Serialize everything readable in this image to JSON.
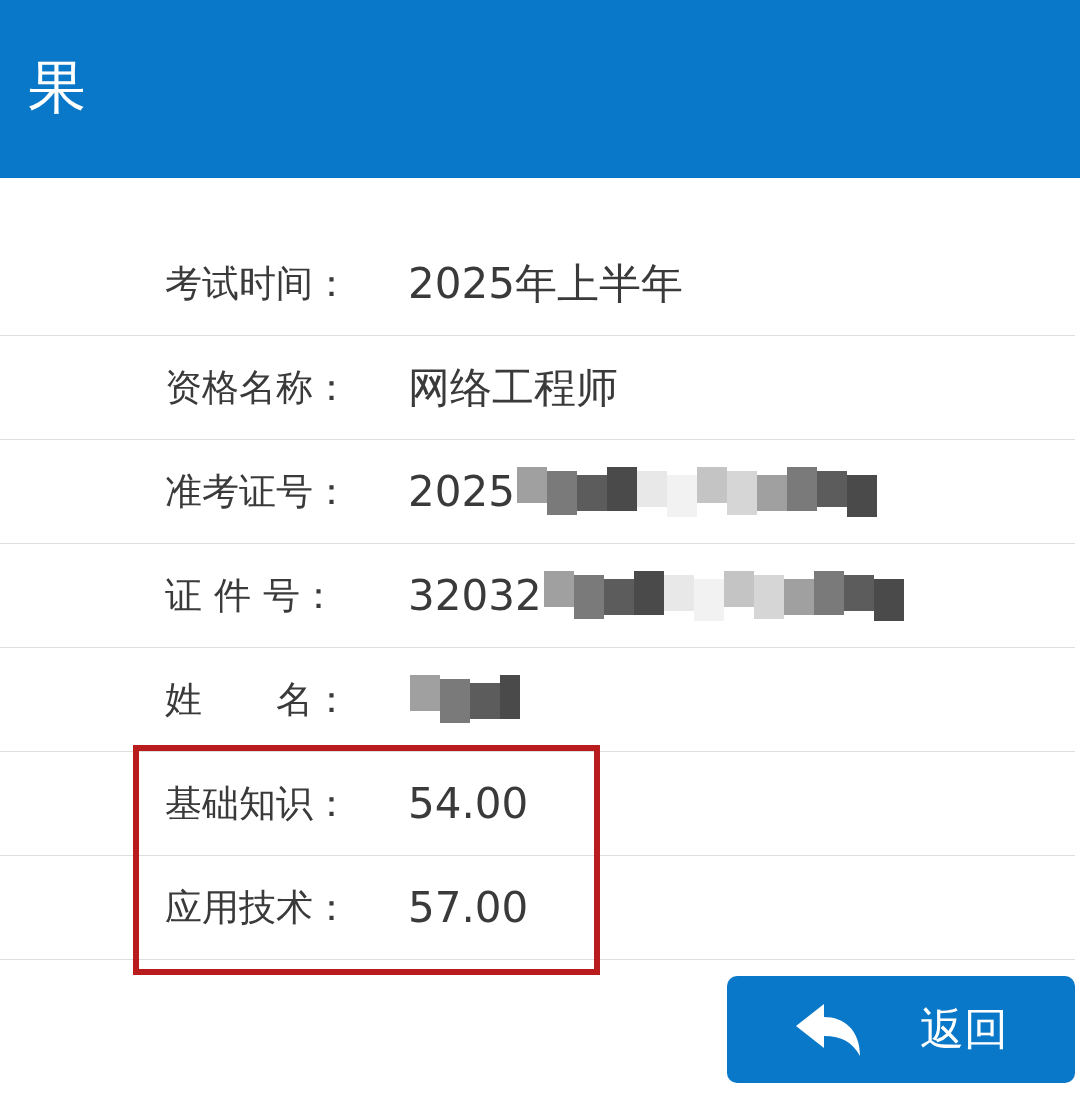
{
  "header": {
    "title": "果"
  },
  "fields": [
    {
      "label": "考试时间：",
      "value": "2025年上半年",
      "redacted": false,
      "highlighted": false
    },
    {
      "label": "资格名称：",
      "value": "网络工程师",
      "redacted": false,
      "highlighted": false
    },
    {
      "label": "准考证号：",
      "value": "2025",
      "redacted": true,
      "highlighted": false
    },
    {
      "label": "证 件 号：",
      "value": "32032",
      "redacted": true,
      "highlighted": false
    },
    {
      "label": "姓　　名：",
      "redacted": true,
      "highlighted": false
    },
    {
      "label": "基础知识：",
      "value": "54.00",
      "redacted": false,
      "highlighted": true
    },
    {
      "label": "应用技术：",
      "value": "57.00",
      "redacted": false,
      "highlighted": true
    }
  ],
  "back_button": {
    "label": "返回"
  }
}
